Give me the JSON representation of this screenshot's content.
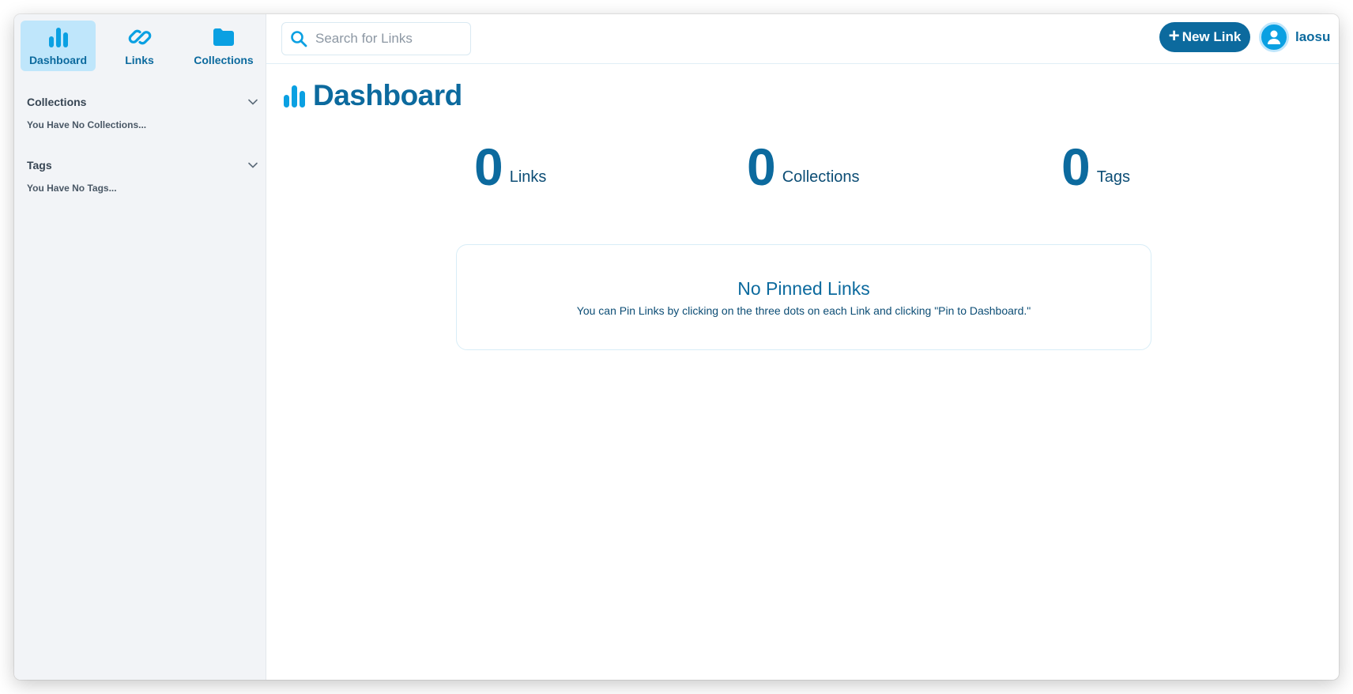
{
  "nav": {
    "tabs": [
      {
        "label": "Dashboard",
        "icon": "chart-bar-icon",
        "active": true
      },
      {
        "label": "Links",
        "icon": "link-icon",
        "active": false
      },
      {
        "label": "Collections",
        "icon": "folder-icon",
        "active": false
      }
    ]
  },
  "sidebar": {
    "collections": {
      "title": "Collections",
      "empty": "You Have No Collections..."
    },
    "tags": {
      "title": "Tags",
      "empty": "You Have No Tags..."
    }
  },
  "topbar": {
    "search_placeholder": "Search for Links",
    "new_link_label": "New Link",
    "username": "laosu"
  },
  "main": {
    "title": "Dashboard",
    "stats": [
      {
        "value": "0",
        "label": "Links"
      },
      {
        "value": "0",
        "label": "Collections"
      },
      {
        "value": "0",
        "label": "Tags"
      }
    ],
    "pinned": {
      "title": "No Pinned Links",
      "subtitle": "You can Pin Links by clicking on the three dots on each Link and clicking \"Pin to Dashboard.\""
    }
  },
  "colors": {
    "primary": "#0c6a9e",
    "accent": "#0aa0e2",
    "active_tab_bg": "#bfe6fb",
    "sidebar_bg": "#f2f4f7"
  }
}
